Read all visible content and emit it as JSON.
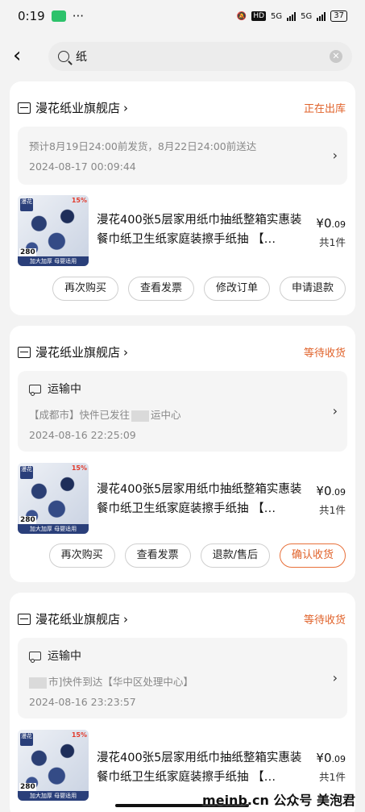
{
  "status_bar": {
    "time": "0:19",
    "dots": "···",
    "hd": "HD",
    "net1": "5G",
    "net2": "5G",
    "battery": "37"
  },
  "search": {
    "query": "纸",
    "clear_icon": "✕"
  },
  "orders": [
    {
      "shop": "漫花纸业旗舰店",
      "status": "正在出库",
      "status_color": "#e0622a",
      "info_line1": "预计8月19日24:00前发货，8月22日24:00前送达",
      "info_line2": "2024-08-17 00:09:44",
      "product_title": "漫花400张5层家用纸巾抽纸整箱实惠装餐巾纸卫生纸家庭装擦手纸抽 【…",
      "price_main": "¥0",
      "price_decimal": ".09",
      "quantity": "共1件",
      "actions": [
        "再次购买",
        "查看发票",
        "修改订单",
        "申请退款"
      ]
    },
    {
      "shop": "漫花纸业旗舰店",
      "status": "等待收货",
      "status_color": "#e0622a",
      "transit_title": "运输中",
      "info_line1_a": "【成都市】快件已发往",
      "info_line1_b": "运中心",
      "info_line2": "2024-08-16 22:25:09",
      "product_title": "漫花400张5层家用纸巾抽纸整箱实惠装餐巾纸卫生纸家庭装擦手纸抽 【…",
      "price_main": "¥0",
      "price_decimal": ".09",
      "quantity": "共1件",
      "actions": [
        "再次购买",
        "查看发票",
        "退款/售后",
        "确认收货"
      ]
    },
    {
      "shop": "漫花纸业旗舰店",
      "status": "等待收货",
      "status_color": "#e0622a",
      "transit_title": "运输中",
      "info_line1": "市]快件到达【华中区处理中心】",
      "info_line2": "2024-08-16 23:23:57",
      "product_title": "漫花400张5层家用纸巾抽纸整箱实惠装餐巾纸卫生纸家庭装擦手纸抽 【…",
      "price_main": "¥0",
      "price_decimal": ".09",
      "quantity": "共1件"
    }
  ],
  "thumbnail": {
    "brand": "漫花",
    "sale": "15%",
    "count": "280",
    "ribbon": "加大加厚 母婴适用"
  },
  "watermark": "meinb.cn 公众号 美泡君",
  "icons": {
    "back": "chevron-left-icon",
    "search": "search-icon",
    "shop": "store-icon",
    "transit": "truck-icon",
    "arrow": "chevron-right-icon"
  }
}
